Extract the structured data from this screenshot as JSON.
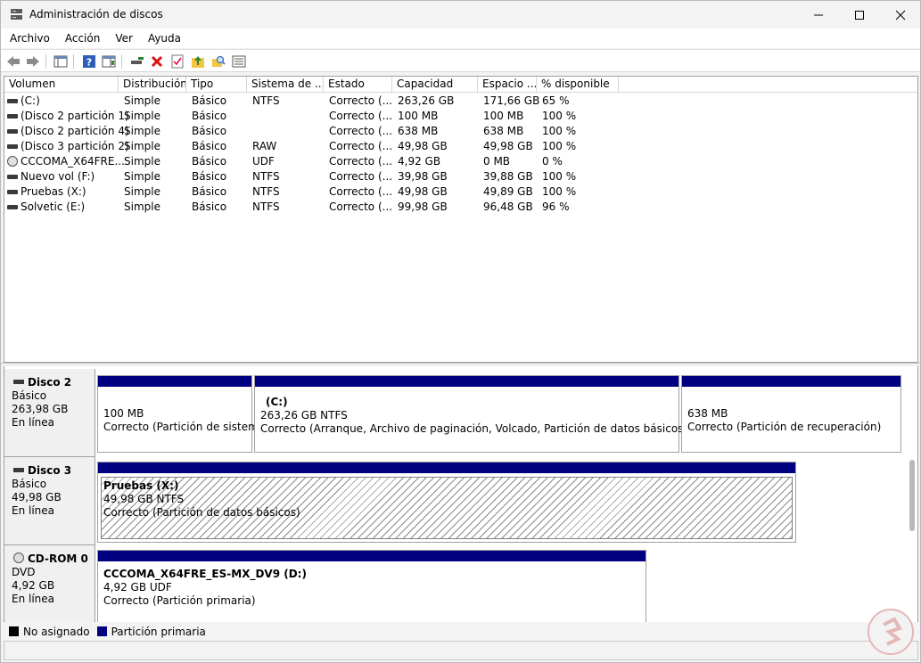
{
  "window": {
    "title": "Administración de discos"
  },
  "menu": [
    "Archivo",
    "Acción",
    "Ver",
    "Ayuda"
  ],
  "columns": [
    "Volumen",
    "Distribución",
    "Tipo",
    "Sistema de ...",
    "Estado",
    "Capacidad",
    "Espacio ...",
    "% disponible"
  ],
  "volumes": [
    {
      "icon": "disk-icon",
      "name": "(C:)",
      "layout": "Simple",
      "type": "Básico",
      "fs": "NTFS",
      "status": "Correcto (...",
      "capacity": "263,26 GB",
      "free": "171,66 GB",
      "pct": "65 %"
    },
    {
      "icon": "disk-icon",
      "name": "(Disco 2 partición 1)",
      "layout": "Simple",
      "type": "Básico",
      "fs": "",
      "status": "Correcto (...",
      "capacity": "100 MB",
      "free": "100 MB",
      "pct": "100 %"
    },
    {
      "icon": "disk-icon",
      "name": "(Disco 2 partición 4)",
      "layout": "Simple",
      "type": "Básico",
      "fs": "",
      "status": "Correcto (...",
      "capacity": "638 MB",
      "free": "638 MB",
      "pct": "100 %"
    },
    {
      "icon": "disk-icon",
      "name": "(Disco 3 partición 2)",
      "layout": "Simple",
      "type": "Básico",
      "fs": "RAW",
      "status": "Correcto (...",
      "capacity": "49,98 GB",
      "free": "49,98 GB",
      "pct": "100 %"
    },
    {
      "icon": "cd-icon",
      "name": "CCCOMA_X64FRE...",
      "layout": "Simple",
      "type": "Básico",
      "fs": "UDF",
      "status": "Correcto (...",
      "capacity": "4,92 GB",
      "free": "0 MB",
      "pct": "0 %"
    },
    {
      "icon": "disk-icon",
      "name": "Nuevo vol (F:)",
      "layout": "Simple",
      "type": "Básico",
      "fs": "NTFS",
      "status": "Correcto (...",
      "capacity": "39,98 GB",
      "free": "39,88 GB",
      "pct": "100 %"
    },
    {
      "icon": "disk-icon",
      "name": "Pruebas (X:)",
      "layout": "Simple",
      "type": "Básico",
      "fs": "NTFS",
      "status": "Correcto (...",
      "capacity": "49,98 GB",
      "free": "49,89 GB",
      "pct": "100 %"
    },
    {
      "icon": "disk-icon",
      "name": "Solvetic (E:)",
      "layout": "Simple",
      "type": "Básico",
      "fs": "NTFS",
      "status": "Correcto (...",
      "capacity": "99,98 GB",
      "free": "96,48 GB",
      "pct": "96 %"
    }
  ],
  "disks": [
    {
      "name": "Disco 2",
      "type": "Básico",
      "size": "263,98 GB",
      "state": "En línea",
      "partitions": [
        {
          "title": "",
          "size": "100 MB",
          "status": "Correcto (Partición de sistema"
        },
        {
          "title": "(C:)",
          "size": "263,26 GB NTFS",
          "status": "Correcto (Arranque, Archivo de paginación, Volcado, Partición de datos básicos)"
        },
        {
          "title": "",
          "size": "638 MB",
          "status": "Correcto (Partición de recuperación)"
        }
      ]
    },
    {
      "name": "Disco 3",
      "type": "Básico",
      "size": "49,98 GB",
      "state": "En línea",
      "partitions": [
        {
          "title": "Pruebas  (X:)",
          "size": "49,98 GB NTFS",
          "status": "Correcto (Partición de datos básicos)"
        }
      ]
    },
    {
      "name": "CD-ROM 0",
      "type": "DVD",
      "size": "4,92 GB",
      "state": "En línea",
      "partitions": [
        {
          "title": "CCCOMA_X64FRE_ES-MX_DV9  (D:)",
          "size": "4,92 GB UDF",
          "status": "Correcto (Partición primaria)"
        }
      ]
    }
  ],
  "legend": [
    {
      "label": "No asignado",
      "color": "#000000"
    },
    {
      "label": "Partición primaria",
      "color": "#000080"
    }
  ],
  "colors": {
    "primary_partition": "#000080",
    "unallocated": "#000000"
  }
}
